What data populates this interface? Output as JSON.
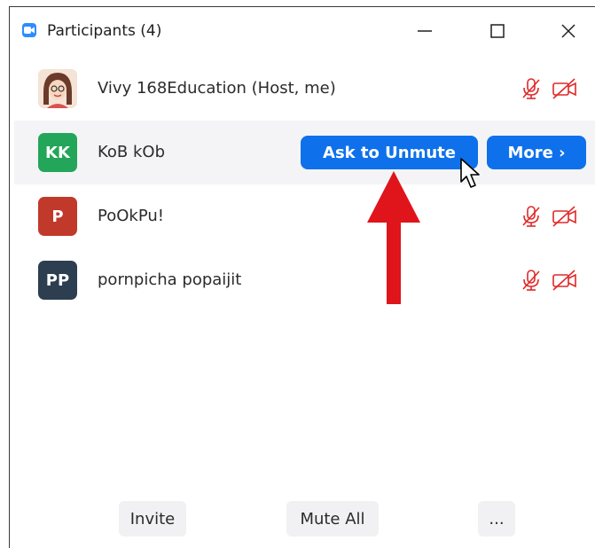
{
  "window": {
    "title": "Participants (4)",
    "controls": [
      "minimize-icon",
      "maximize-icon",
      "close-icon"
    ],
    "accent": "#2D8CFF"
  },
  "participants": [
    {
      "name": "Vivy 168Education (Host, me)",
      "initials": "",
      "avatar": "photo",
      "avatar_color": "#7a4a3a",
      "mic": "muted",
      "video": "off"
    },
    {
      "name": "KoB kOb",
      "initials": "KK",
      "avatar_color": "#23A55A",
      "hovered": true,
      "actions": {
        "ask_label": "Ask to Unmute",
        "more_label": "More ›"
      }
    },
    {
      "name": "PoOkPu!",
      "initials": "P",
      "avatar_color": "#C0392B",
      "mic": "muted",
      "video": "off"
    },
    {
      "name": "pornpicha popaijit",
      "initials": "PP",
      "avatar_color": "#2C3E50",
      "mic": "muted",
      "video": "off"
    }
  ],
  "footer": {
    "invite_label": "Invite",
    "mute_all_label": "Mute All",
    "more_label": "..."
  },
  "colors": {
    "muted_red": "#E02828",
    "button_blue": "#0E71EB",
    "annotation_arrow": "#E0141B"
  }
}
